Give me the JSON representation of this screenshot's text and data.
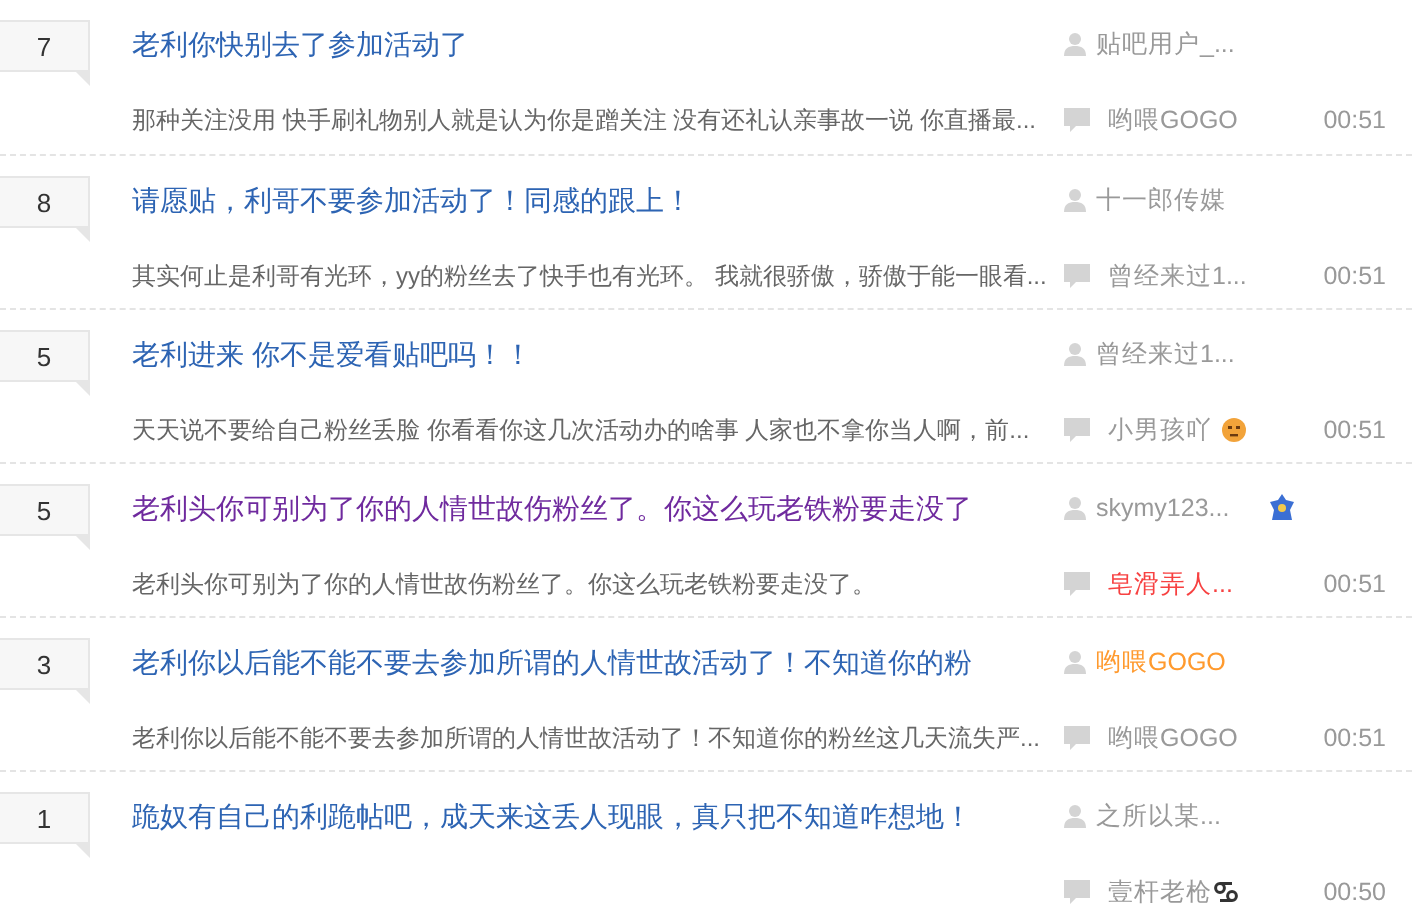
{
  "threads": [
    {
      "reply_count": "7",
      "title": "老利你快别去了参加活动了",
      "visited": false,
      "author": {
        "name": "贴吧用户_...",
        "color": "#999999"
      },
      "excerpt": "那种关注没用 快手刷礼物别人就是认为你是蹭关注 没有还礼认亲事故一说 你直播最...",
      "last_reply": {
        "name": "哟喂GOGO",
        "color": "#999999"
      },
      "time": "00:51"
    },
    {
      "reply_count": "8",
      "title": "请愿贴，利哥不要参加活动了！同感的跟上！",
      "visited": false,
      "author": {
        "name": "十一郎传媒",
        "color": "#999999"
      },
      "excerpt": "其实何止是利哥有光环，yy的粉丝去了快手也有光环。 我就很骄傲，骄傲于能一眼看...",
      "last_reply": {
        "name": "曾经来过1...",
        "color": "#999999"
      },
      "time": "00:51"
    },
    {
      "reply_count": "5",
      "title": "老利进来 你不是爱看贴吧吗！！",
      "visited": false,
      "author": {
        "name": "曾经来过1...",
        "color": "#999999"
      },
      "excerpt": "天天说不要给自己粉丝丢脸 你看看你这几次活动办的啥事 人家也不拿你当人啊，前...",
      "last_reply": {
        "name": "小男孩吖",
        "color": "#999999",
        "emoji_badge": true
      },
      "time": "00:51"
    },
    {
      "reply_count": "5",
      "title": "老利头你可别为了你的人情世故伤粉丝了。你这么玩老铁粉要走没了",
      "visited": true,
      "author": {
        "name": "skymy123...",
        "color": "#999999",
        "medal_badge": true
      },
      "excerpt": "老利头你可别为了你的人情世故伤粉丝了。你这么玩老铁粉要走没了。",
      "last_reply": {
        "name": "皂滑弄人...",
        "color": "#f74141"
      },
      "time": "00:51"
    },
    {
      "reply_count": "3",
      "title": "老利你以后能不能不要去参加所谓的人情世故活动了！不知道你的粉",
      "visited": false,
      "author": {
        "name": "哟喂GOGO",
        "color": "#ff9a2e"
      },
      "excerpt": "老利你以后能不能不要去参加所谓的人情世故活动了！不知道你的粉丝这几天流失严...",
      "last_reply": {
        "name": "哟喂GOGO",
        "color": "#999999"
      },
      "time": "00:51"
    },
    {
      "reply_count": "1",
      "title": "跪奴有自己的利跪帖吧，成天来这丢人现眼，真只把不知道咋想地！",
      "visited": false,
      "author": {
        "name": "之所以某...",
        "color": "#999999"
      },
      "last_reply": {
        "name": "壹杆老枪",
        "color": "#999999",
        "zodiac_badge": true
      },
      "time": "00:50"
    }
  ]
}
